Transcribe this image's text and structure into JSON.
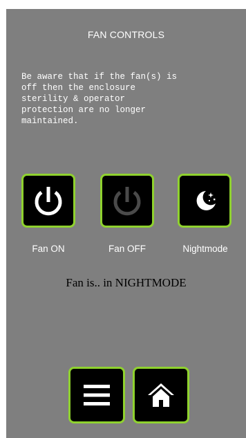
{
  "header": {
    "title": "FAN CONTROLS"
  },
  "warning": {
    "text": "Be aware that if the fan(s) is\noff then the enclosure\nsterility & operator\nprotection are no longer\nmaintained."
  },
  "controls": {
    "fan_on": {
      "label": "Fan ON",
      "icon": "power-icon",
      "icon_color": "#ffffff"
    },
    "fan_off": {
      "label": "Fan OFF",
      "icon": "power-icon",
      "icon_color": "#4a4a4a"
    },
    "nightmode": {
      "label": "Nightmode",
      "icon": "moon-stars-icon"
    }
  },
  "status": {
    "text": "Fan is.. in NIGHTMODE"
  },
  "footer": {
    "menu": {
      "icon": "hamburger-menu-icon"
    },
    "home": {
      "icon": "home-icon"
    }
  },
  "colors": {
    "background": "#7f7f7f",
    "button_fill": "#000000",
    "button_border": "#8fd22e",
    "text": "#ffffff"
  }
}
